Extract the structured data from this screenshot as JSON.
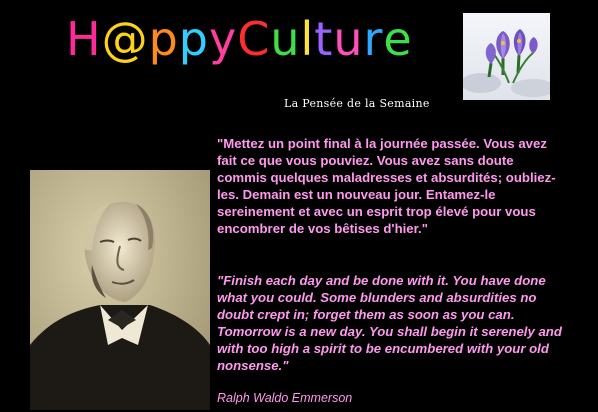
{
  "header": {
    "logo_chars": [
      {
        "ch": "H",
        "color": "#ff2a9a"
      },
      {
        "ch": "@",
        "color": "#ffd21a"
      },
      {
        "ch": "p",
        "color": "#ff8a1c"
      },
      {
        "ch": "p",
        "color": "#2fd0ff"
      },
      {
        "ch": "y",
        "color": "#ff3fa0"
      },
      {
        "ch": "C",
        "color": "#ff2e2e"
      },
      {
        "ch": "u",
        "color": "#3ee04a"
      },
      {
        "ch": "l",
        "color": "#ffe23a"
      },
      {
        "ch": "t",
        "color": "#9a63ff"
      },
      {
        "ch": "u",
        "color": "#ff4fb8"
      },
      {
        "ch": "r",
        "color": "#2fa8ff"
      },
      {
        "ch": "e",
        "color": "#3ee04a"
      }
    ],
    "subtitle": "La Pensée de la Semaine"
  },
  "images": {
    "flower": "crocus-in-snow-photo",
    "portrait": "ralph-waldo-emerson-portrait"
  },
  "quote": {
    "french": "\"Mettez un point final à la journée passée. Vous avez fait ce que vous pouviez. Vous avez sans doute commis quelques maladresses et absurdités; oubliez-les. Demain est un nouveau jour. Entamez-le sereinement et avec un esprit trop élevé pour vous encombrer de vos bêtises d'hier.\"",
    "english": "\"Finish each day and be done with it. You have done what you could. Some blunders and absurdities no doubt crept in; forget them as soon as you can. Tomorrow is a new day. You shall begin it serenely and with too high a spirit to be encumbered with your old nonsense.\"",
    "author": "Ralph Waldo Emmerson"
  },
  "colors": {
    "background": "#000000",
    "quote_text": "#ff99ee",
    "subtitle_text": "#ffffff"
  }
}
